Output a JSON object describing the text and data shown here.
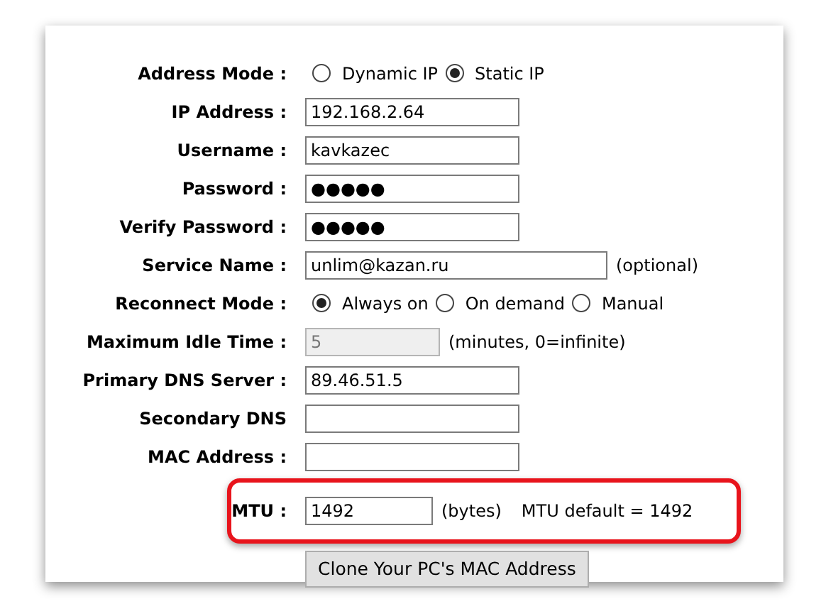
{
  "form": {
    "rows": [
      {
        "kind": "radio",
        "label": "Address Mode :",
        "options": [
          {
            "label": "Dynamic IP",
            "selected": false
          },
          {
            "label": "Static IP",
            "selected": true
          }
        ]
      },
      {
        "kind": "field",
        "label": "IP Address :",
        "value": "192.168.2.64",
        "disabled": false
      },
      {
        "kind": "field",
        "label": "Username :",
        "value": "kavkazec",
        "disabled": false
      },
      {
        "kind": "field",
        "label": "Password :",
        "value": "●●●●●",
        "disabled": false
      },
      {
        "kind": "field",
        "label": "Verify Password :",
        "value": "●●●●●",
        "disabled": false
      },
      {
        "kind": "field",
        "label": "Service Name :",
        "value": "unlim@kazan.ru",
        "note": "(optional)",
        "disabled": false
      },
      {
        "kind": "radio",
        "label": "Reconnect Mode :",
        "options": [
          {
            "label": "Always on",
            "selected": true
          },
          {
            "label": "On demand",
            "selected": false
          },
          {
            "label": "Manual",
            "selected": false
          }
        ]
      },
      {
        "kind": "field",
        "label": "Maximum Idle Time :",
        "value": "5",
        "note": "(minutes, 0=infinite)",
        "disabled": true
      },
      {
        "kind": "field",
        "label": "Primary DNS Server :",
        "value": "89.46.51.5",
        "disabled": false
      },
      {
        "kind": "field",
        "label": "Secondary DNS",
        "disabled": false
      },
      {
        "kind": "field",
        "label": "MAC Address :",
        "disabled": false
      },
      {
        "kind": "button",
        "label": "Clone Your PC's MAC Address"
      }
    ]
  },
  "callout": {
    "label": "MTU :",
    "value": "1492",
    "unit": "(bytes)",
    "note": "MTU default = 1492"
  }
}
